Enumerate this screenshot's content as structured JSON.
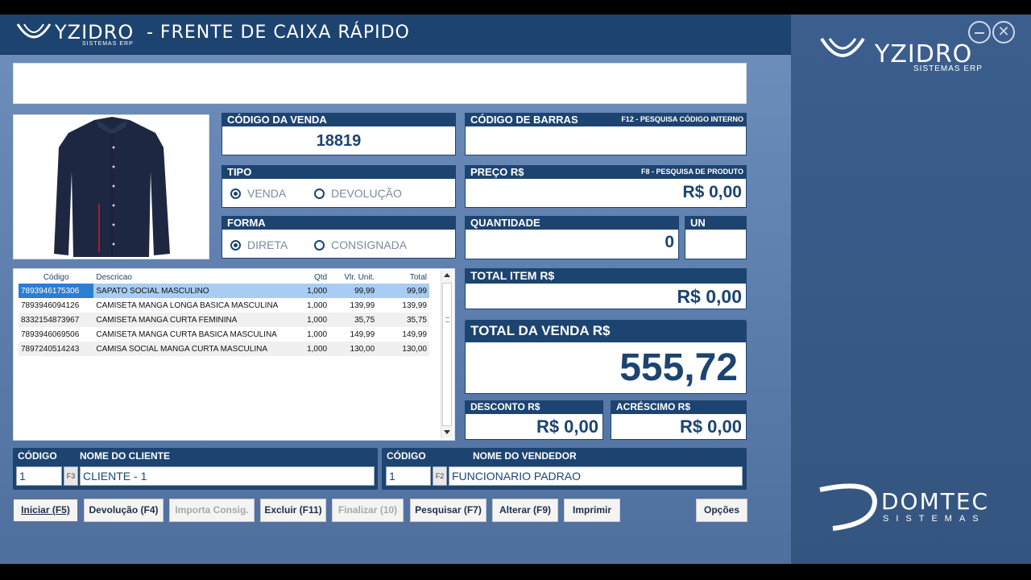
{
  "app": {
    "brand": "YZIDRO",
    "brand_sub": "SISTEMAS ERP",
    "title": "- FRENTE DE CAIXA RÁPIDO",
    "footer_brand": "DOMTEC",
    "footer_sub": "SISTEMAS"
  },
  "colors": {
    "primary": "#1d4470",
    "background": "#6f8fbc",
    "selection": "#a9cdf2",
    "selection_code": "#2a7ed3"
  },
  "product_image": "shirt-image",
  "sale_code": {
    "label": "CÓDIGO DA VENDA",
    "value": "18819"
  },
  "barcode": {
    "label": "CÓDIGO DE BARRAS",
    "hint": "F12 - PESQUISA CÓDIGO INTERNO",
    "value": ""
  },
  "tipo": {
    "label": "TIPO",
    "options": [
      "VENDA",
      "DEVOLUÇÃO"
    ],
    "selected": "VENDA"
  },
  "forma": {
    "label": "FORMA",
    "options": [
      "DIRETA",
      "CONSIGNADA"
    ],
    "selected": "DIRETA"
  },
  "price": {
    "label": "PREÇO R$",
    "hint": "F8 - PESQUISA DE PRODUTO",
    "value": "R$ 0,00"
  },
  "quantity": {
    "label": "QUANTIDADE",
    "value": "0"
  },
  "unit": {
    "label": "UN",
    "value": ""
  },
  "total_item": {
    "label": "TOTAL ITEM R$",
    "value": "R$ 0,00"
  },
  "total_sale": {
    "label": "TOTAL DA VENDA R$",
    "value": "555,72"
  },
  "discount": {
    "label": "DESCONTO R$",
    "value": "R$ 0,00"
  },
  "surcharge": {
    "label": "ACRÉSCIMO R$",
    "value": "R$ 0,00"
  },
  "grid": {
    "columns": [
      "Código",
      "Descricao",
      "Qtd",
      "Vlr. Unit.",
      "Total"
    ],
    "rows": [
      [
        "7893946175306",
        "SAPATO SOCIAL MASCULINO",
        "1,000",
        "99,99",
        "99,99"
      ],
      [
        "7893946094126",
        "CAMISETA MANGA LONGA BASICA MASCULINA",
        "1,000",
        "139,99",
        "139,99"
      ],
      [
        "8332154873967",
        "CAMISETA MANGA CURTA FEMININA",
        "1,000",
        "35,75",
        "35,75"
      ],
      [
        "7893946069506",
        "CAMISETA MANGA CURTA BASICA MASCULINA",
        "1,000",
        "149,99",
        "149,99"
      ],
      [
        "7897240514243",
        "CAMISA SOCIAL MANGA CURTA MASCULINA",
        "1,000",
        "130,00",
        "130,00"
      ]
    ]
  },
  "client": {
    "code_label": "CÓDIGO",
    "name_label": "NOME DO CLIENTE",
    "code": "1",
    "fkey": "F3",
    "name": "CLIENTE - 1"
  },
  "seller": {
    "code_label": "CÓDIGO",
    "name_label": "NOME DO VENDEDOR",
    "code": "1",
    "fkey": "F2",
    "name": "FUNCIONARIO PADRAO"
  },
  "buttons": {
    "start": "Iniciar (F5)",
    "return": "Devolução (F4)",
    "import": "Importa Consig.",
    "delete": "Excluir (F11)",
    "finish": "Finalizar (10)",
    "search": "Pesquisar (F7)",
    "edit": "Alterar (F9)",
    "print": "Imprimir",
    "options": "Opções"
  }
}
